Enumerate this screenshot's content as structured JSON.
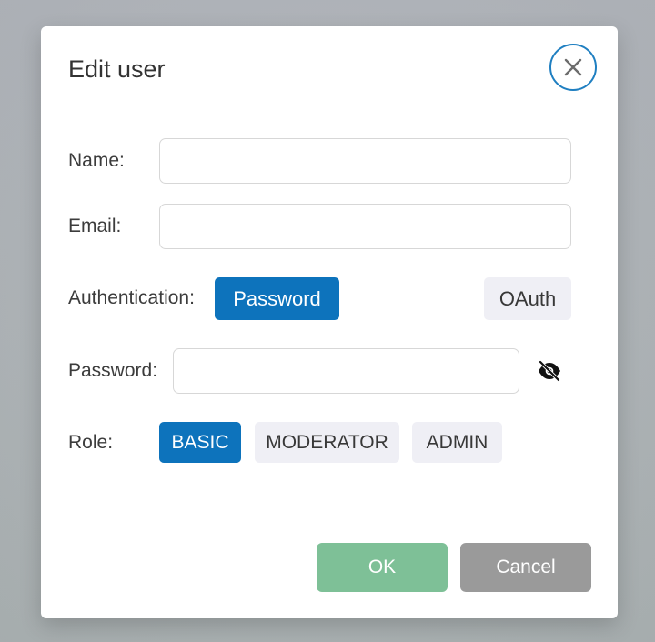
{
  "dialog": {
    "title": "Edit user",
    "close_icon": "close-icon"
  },
  "form": {
    "name_label": "Name:",
    "name_value": "",
    "email_label": "Email:",
    "email_value": "",
    "auth_label": "Authentication:",
    "auth_options": [
      "Password",
      "OAuth"
    ],
    "auth_selected": "Password",
    "password_label": "Password:",
    "password_value": "",
    "password_toggle_icon": "eye-slash-icon",
    "role_label": "Role:",
    "role_options": [
      "BASIC",
      "MODERATOR",
      "ADMIN"
    ],
    "role_selected": "BASIC"
  },
  "footer": {
    "ok_label": "OK",
    "cancel_label": "Cancel"
  },
  "colors": {
    "primary": "#0d73bc",
    "close_border": "#1f7fc1",
    "ok": "#7ec097",
    "cancel": "#9a9a9a",
    "unselected": "#efeff5"
  }
}
